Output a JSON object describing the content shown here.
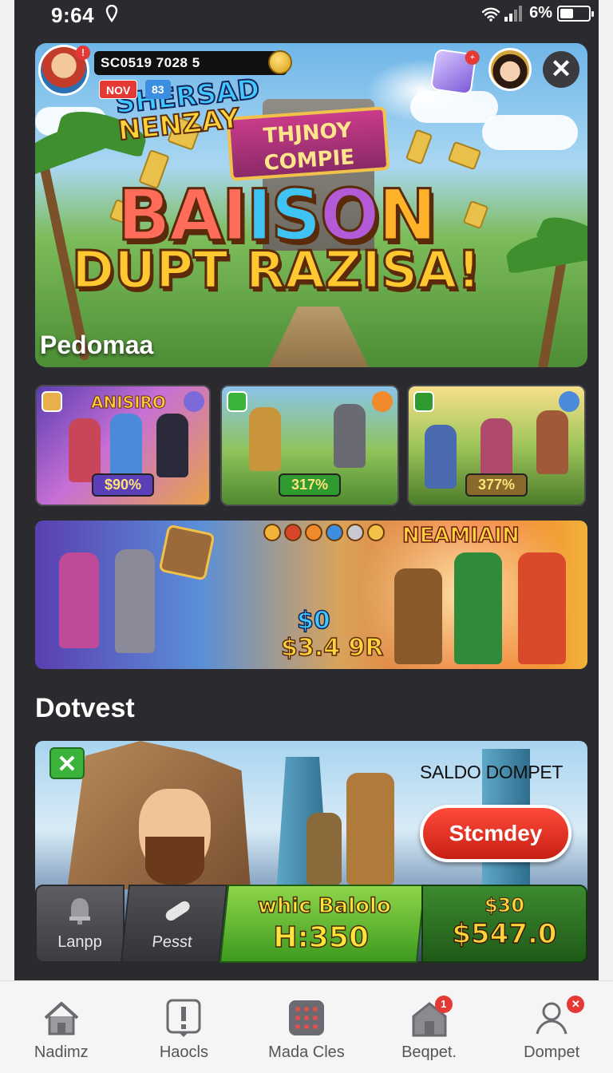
{
  "status_bar": {
    "time": "9:64",
    "battery_text": "6%"
  },
  "hero": {
    "score": "SC0519 7028 5",
    "tag_new": "NOV",
    "tag_level": "83",
    "sign_line1": "THJNOY",
    "sign_line2": "COMPIE",
    "title_part1": "BAI",
    "title_part2": "IS",
    "title_part3": "O",
    "title_part4": "N",
    "subtitle": "DUPT RAZISA!",
    "caption": "Pedomaa",
    "close_glyph": "✕"
  },
  "cards": [
    {
      "title": "ANISIRO",
      "badge": "$90%"
    },
    {
      "title": "",
      "badge": "317%"
    },
    {
      "title": "",
      "badge": "377%"
    }
  ],
  "banner": {
    "title_line1": "SHERSAD",
    "title_line2": "NENZAY",
    "amount_line1": "$0",
    "amount_line2": "$3.4 9R",
    "tag": "NEAMIAIN"
  },
  "section": {
    "title": "Dotvest"
  },
  "wallet": {
    "label": "SALDO DOMPET",
    "cta": "Stcmdey",
    "check_glyph": "✕",
    "bar": {
      "item1_label": "Lanpp",
      "item2_label": "Pesst",
      "green_line1": "whic Balolo",
      "green_line2": "H:350",
      "dark_line1": "$30",
      "dark_line2": "$547.0"
    }
  },
  "bottom_nav": [
    {
      "label": "Nadimz",
      "icon": "home-icon"
    },
    {
      "label": "Haocls",
      "icon": "alert-icon"
    },
    {
      "label": "Mada Cles",
      "icon": "grid-icon"
    },
    {
      "label": "Beqpet.",
      "icon": "shop-icon",
      "badge": "1"
    },
    {
      "label": "Dompet",
      "icon": "profile-icon"
    }
  ],
  "colors": {
    "accent_red": "#e53935",
    "cta_red": "#d8281c",
    "app_bg": "#2b2a2e",
    "gold": "#ffd23a"
  }
}
